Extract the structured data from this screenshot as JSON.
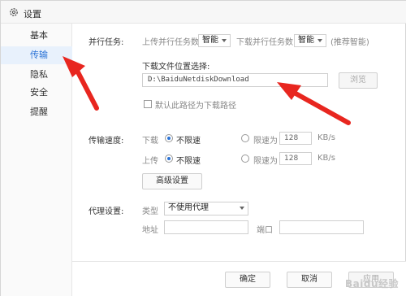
{
  "window": {
    "title": "设置"
  },
  "sidebar": {
    "items": [
      {
        "label": "基本"
      },
      {
        "label": "传输",
        "active": true
      },
      {
        "label": "隐私"
      },
      {
        "label": "安全"
      },
      {
        "label": "提醒"
      }
    ]
  },
  "parallel": {
    "section_label": "并行任务:",
    "upload_label": "上传并行任务数",
    "upload_value": "智能",
    "download_label": "下载并行任务数",
    "download_value": "智能",
    "hint": "(推荐智能)"
  },
  "download_path": {
    "label": "下载文件位置选择:",
    "value": "D:\\BaiduNetdiskDownload",
    "browse_label": "浏览",
    "default_checkbox_label": "默认此路径为下载路径",
    "default_checked": false
  },
  "speed": {
    "section_label": "传输速度:",
    "download_label": "下载",
    "upload_label": "上传",
    "unlimited_label": "不限速",
    "limit_label": "限速为",
    "download_limit_value": "128",
    "upload_limit_value": "128",
    "unit": "KB/s",
    "download_mode": "unlimited",
    "upload_mode": "unlimited",
    "advanced_label": "高级设置"
  },
  "proxy": {
    "section_label": "代理设置:",
    "type_label": "类型",
    "type_value": "不使用代理",
    "address_label": "地址",
    "port_label": "端口",
    "address_value": "",
    "port_value": ""
  },
  "footer": {
    "ok_label": "确定",
    "cancel_label": "取消",
    "apply_label": "应用"
  },
  "watermark": "Baidu经验",
  "colors": {
    "accent": "#2b73d6",
    "arrow": "#e8261f",
    "active_bg": "#e8f1fc"
  },
  "icons": {
    "title": "gear-icon"
  }
}
